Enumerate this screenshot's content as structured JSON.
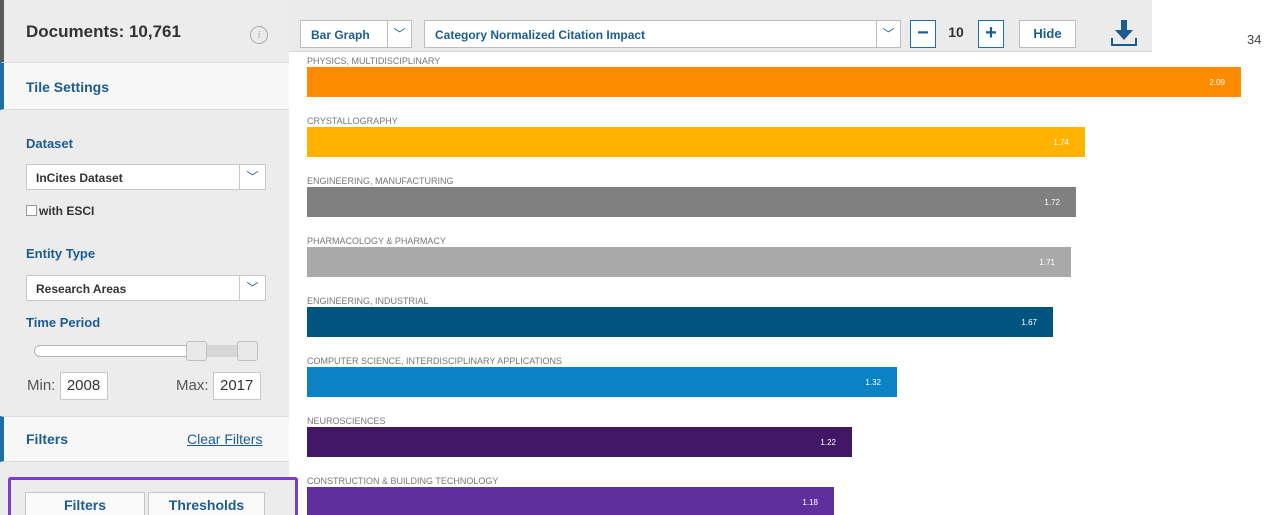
{
  "sidebar": {
    "documents_label": "Documents: 10,761",
    "info_icon": "i",
    "tile_settings": "Tile Settings",
    "dataset_label": "Dataset",
    "dataset_value": "InCites Dataset",
    "esci_label": "with ESCI",
    "entity_type_label": "Entity Type",
    "entity_type_value": "Research Areas",
    "time_period_label": "Time Period",
    "min_label": "Min:",
    "min_value": "2008",
    "max_label": "Max:",
    "max_value": "2017",
    "filters_label": "Filters",
    "clear_filters": "Clear Filters",
    "tab_filters": "Filters",
    "tab_thresholds": "Thresholds"
  },
  "toolbar": {
    "chart_type": "Bar Graph",
    "indicator": "Category Normalized Citation Impact",
    "count": "10",
    "minus": "−",
    "plus": "+",
    "hide": "Hide",
    "page_number": "34"
  },
  "chart_data": {
    "type": "bar",
    "orientation": "horizontal",
    "categories": [
      "PHYSICS, MULTIDISCIPLINARY",
      "CRYSTALLOGRAPHY",
      "ENGINEERING, MANUFACTURING",
      "PHARMACOLOGY & PHARMACY",
      "ENGINEERING, INDUSTRIAL",
      "COMPUTER SCIENCE, INTERDISCIPLINARY APPLICATIONS",
      "NEUROSCIENCES",
      "CONSTRUCTION & BUILDING TECHNOLOGY"
    ],
    "values": [
      2.09,
      1.74,
      1.72,
      1.71,
      1.67,
      1.32,
      1.22,
      1.18
    ],
    "value_labels": [
      "2.09",
      "1.74",
      "1.72",
      "1.71",
      "1.67",
      "1.32",
      "1.22",
      "1.18"
    ],
    "colors": [
      "#ff8c00",
      "#ffb300",
      "#808080",
      "#a9a9a9",
      "#005580",
      "#0a82c4",
      "#421766",
      "#5f2f9e"
    ],
    "xlim": [
      0,
      2.09
    ]
  }
}
